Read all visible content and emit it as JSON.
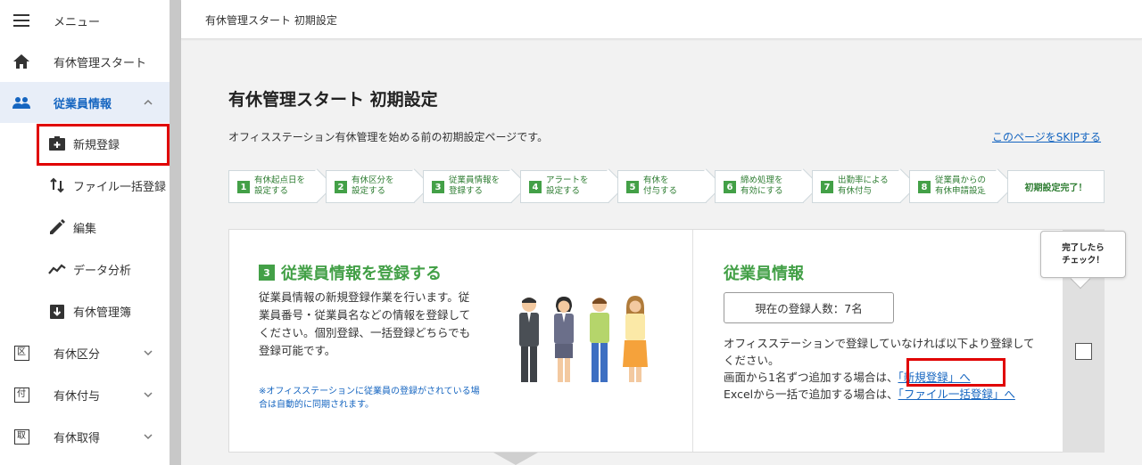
{
  "sidebar": {
    "menu_label": "メニュー",
    "items": [
      {
        "label": "有休管理スタート",
        "icon": "home-icon"
      },
      {
        "label": "従業員情報",
        "icon": "people-icon"
      },
      {
        "label": "新規登録",
        "icon": "add-user-icon"
      },
      {
        "label": "ファイル一括登録",
        "icon": "sort-arrows-icon"
      },
      {
        "label": "編集",
        "icon": "pencil-icon"
      },
      {
        "label": "データ分析",
        "icon": "trend-icon"
      },
      {
        "label": "有休管理簿",
        "icon": "download-doc-icon"
      },
      {
        "label": "有休区分",
        "icon": "ku-box-icon",
        "glyph": "区"
      },
      {
        "label": "有休付与",
        "icon": "fu-box-icon",
        "glyph": "付"
      },
      {
        "label": "有休取得",
        "icon": "shu-box-icon",
        "glyph": "取"
      }
    ]
  },
  "topbar": {
    "title": "有休管理スタート 初期設定"
  },
  "page": {
    "title": "有休管理スタート 初期設定",
    "description": "オフィスステーション有休管理を始める前の初期設定ページです。",
    "skip_link": "このページをSKIPする"
  },
  "steps": [
    {
      "num": "1",
      "text": "有休起点日を\n設定する"
    },
    {
      "num": "2",
      "text": "有休区分を\n設定する"
    },
    {
      "num": "3",
      "text": "従業員情報を\n登録する"
    },
    {
      "num": "4",
      "text": "アラートを\n設定する"
    },
    {
      "num": "5",
      "text": "有休を\n付与する"
    },
    {
      "num": "6",
      "text": "締め処理を\n有効にする"
    },
    {
      "num": "7",
      "text": "出勤率による\n有休付与"
    },
    {
      "num": "8",
      "text": "従業員からの\n有休申請設定"
    }
  ],
  "steps_final": "初期設定完了！",
  "card": {
    "left": {
      "num": "3",
      "title": "従業員情報を登録する",
      "body": "従業員情報の新規登録作業を行います。従業員番号・従業員名などの情報を登録してください。個別登録、一括登録どちらでも登録可能です。",
      "note": "※オフィスステーションに従業員の登録がされている場合は自動的に同期されます。"
    },
    "right": {
      "title": "従業員情報",
      "count_text": "現在の登録人数：7名",
      "line1": "オフィスステーションで登録していなければ以下より登録してください。",
      "line2_prefix": "画面から1名ずつ追加する場合は、",
      "line2_link": "「新規登録」へ",
      "line3_prefix": "Excelから一括で追加する場合は、",
      "line3_link": "「ファイル一括登録」へ"
    }
  },
  "check": {
    "bubble_line1": "完了したら",
    "bubble_line2": "チェック！",
    "checked": false
  },
  "colors": {
    "accent_green": "#43a047",
    "link_blue": "#1565c0",
    "highlight_red": "#e00000"
  }
}
